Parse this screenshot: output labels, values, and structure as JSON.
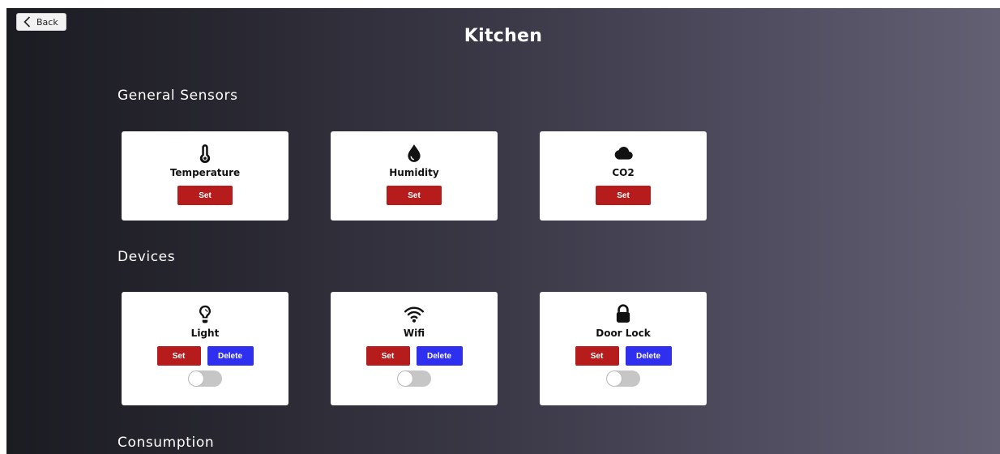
{
  "header": {
    "back_label": "Back",
    "title": "Kitchen"
  },
  "sections": {
    "sensors_title": "General Sensors",
    "devices_title": "Devices",
    "consumption_title": "Consumption"
  },
  "sensors": [
    {
      "label": "Temperature",
      "icon": "thermometer-icon",
      "set_label": "Set"
    },
    {
      "label": "Humidity",
      "icon": "droplet-icon",
      "set_label": "Set"
    },
    {
      "label": "CO2",
      "icon": "cloud-icon",
      "set_label": "Set"
    }
  ],
  "devices": [
    {
      "label": "Light",
      "icon": "lightbulb-icon",
      "set_label": "Set",
      "delete_label": "Delete",
      "on": false
    },
    {
      "label": "Wifi",
      "icon": "wifi-icon",
      "set_label": "Set",
      "delete_label": "Delete",
      "on": false
    },
    {
      "label": "Door Lock",
      "icon": "lock-icon",
      "set_label": "Set",
      "delete_label": "Delete",
      "on": false
    }
  ],
  "colors": {
    "set_button": "#b71c1c",
    "delete_button": "#2f2ff0",
    "toggle_off": "#c6c6c6"
  }
}
